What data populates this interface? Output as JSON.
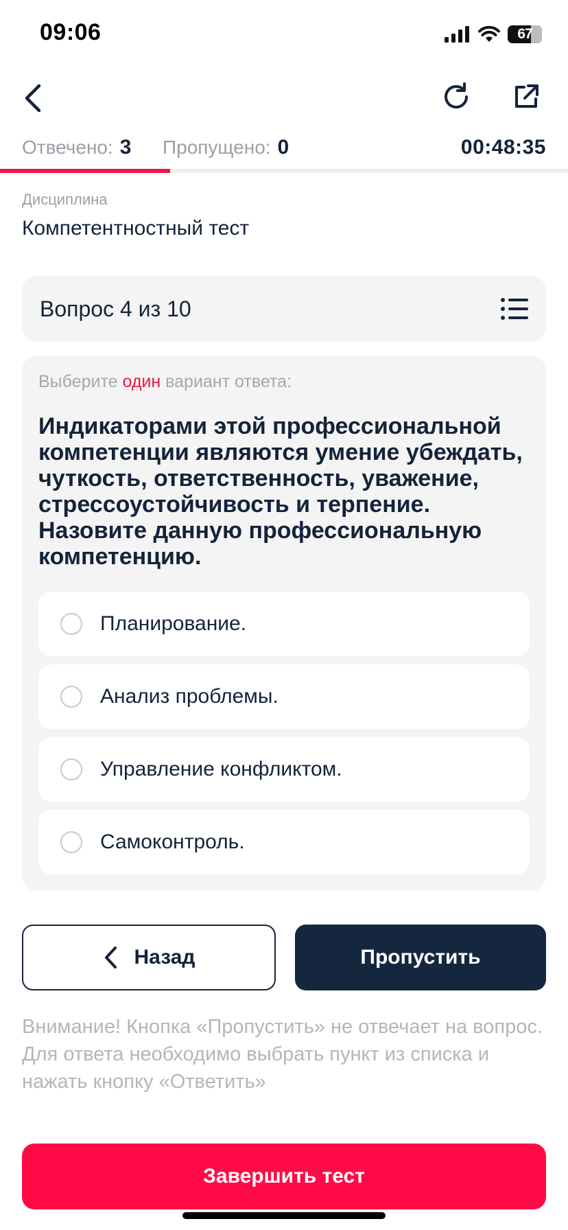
{
  "status_bar": {
    "time": "09:06",
    "battery": "67",
    "battery_level": 0.67,
    "icons": [
      "cellular-signal-icon",
      "wifi-icon",
      "battery-icon"
    ]
  },
  "nav": {
    "back_icon": "chevron-left-icon",
    "refresh_icon": "refresh-icon",
    "share_icon": "external-link-icon"
  },
  "counters": {
    "answered_label": "Отвечено:",
    "answered_value": "3",
    "skipped_label": "Пропущено:",
    "skipped_value": "0",
    "timer": "00:48:35"
  },
  "progress": {
    "fraction": 0.3,
    "color": "#ea1846"
  },
  "discipline": {
    "label": "Дисциплина",
    "value": "Компетентностный тест"
  },
  "question_header": {
    "title": "Вопрос 4 из 10",
    "list_icon": "list-icon"
  },
  "question": {
    "instruction_before": "Выберите ",
    "instruction_highlight": "один",
    "instruction_after": " вариант ответа:",
    "text": "Индикаторами этой профессиональной компетенции являются умение убеждать, чуткость, ответственность, уважение, стрессоустойчивость и терпение. Назовите данную профессиональную компетенцию.",
    "options": [
      {
        "label": "Планирование.",
        "selected": false
      },
      {
        "label": "Анализ проблемы.",
        "selected": false
      },
      {
        "label": "Управление конфликтом.",
        "selected": false
      },
      {
        "label": "Самоконтроль.",
        "selected": false
      }
    ]
  },
  "buttons": {
    "back_label": "Назад",
    "skip_label": "Пропустить",
    "finish_label": "Завершить тест"
  },
  "notice": "Внимание! Кнопка «Пропустить» не отвечает на вопрос. Для ответа необходимо выбрать пункт из списка и нажать кнопку «Ответить»",
  "colors": {
    "accent": "#ea1846",
    "primary_dark": "#14273f",
    "finish_button": "#ff0a47"
  }
}
